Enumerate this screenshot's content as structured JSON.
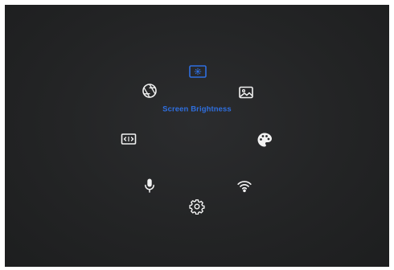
{
  "radial_menu": {
    "selected_label": "Screen Brightness",
    "accent_color": "#2f6fe0",
    "icon_color": "#f2f2f2",
    "items": [
      {
        "icon": "screen-brightness-icon",
        "selected": true
      },
      {
        "icon": "image-icon",
        "selected": false
      },
      {
        "icon": "palette-icon",
        "selected": false
      },
      {
        "icon": "wifi-icon",
        "selected": false
      },
      {
        "icon": "gear-icon",
        "selected": false
      },
      {
        "icon": "microphone-icon",
        "selected": false
      },
      {
        "icon": "aspect-ratio-icon",
        "selected": false
      },
      {
        "icon": "aperture-icon",
        "selected": false
      }
    ]
  }
}
